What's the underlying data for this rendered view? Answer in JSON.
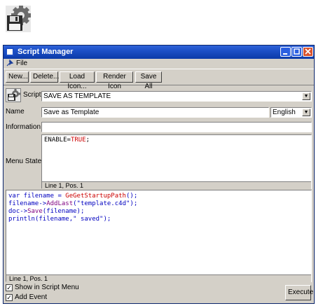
{
  "window": {
    "title": "Script Manager"
  },
  "menubar": {
    "file": "File"
  },
  "toolbar": {
    "new_label": "New...",
    "delete_label": "Delete...",
    "load_icon_label": "Load Icon...",
    "render_icon_label": "Render Icon",
    "save_all_label": "Save All"
  },
  "script": {
    "label": "Script",
    "selected": "SAVE AS TEMPLATE"
  },
  "name": {
    "label": "Name",
    "value": "Save as Template",
    "language": "English"
  },
  "information": {
    "label": "Information",
    "value": ""
  },
  "menu_state": {
    "label": "Menu State",
    "code_ident": "ENABLE=",
    "code_value": "TRUE",
    "code_end": ";",
    "status": "Line 1, Pos. 1"
  },
  "editor": {
    "lines": [
      {
        "a": "var filename = ",
        "b": "GeGetStartupPath",
        "c": "();"
      },
      {
        "a": "filename->",
        "b": "AddLast",
        "c": "(\"template.c4d\");"
      },
      {
        "a": "doc->",
        "b": "Save",
        "c": "(filename);"
      },
      {
        "a": "println",
        "b": "",
        "c": "(filename,\" saved\");"
      }
    ],
    "status": "Line 1, Pos. 1"
  },
  "options": {
    "show_in_menu": "Show in Script Menu",
    "add_event": "Add Event",
    "show_in_menu_checked": true,
    "add_event_checked": true
  },
  "execute_label": "Execute",
  "colors": {
    "titlebar": "#1c4fc6",
    "window_bg": "#d4d0c8",
    "code_blue": "#0000c0",
    "code_red": "#cc0000"
  }
}
